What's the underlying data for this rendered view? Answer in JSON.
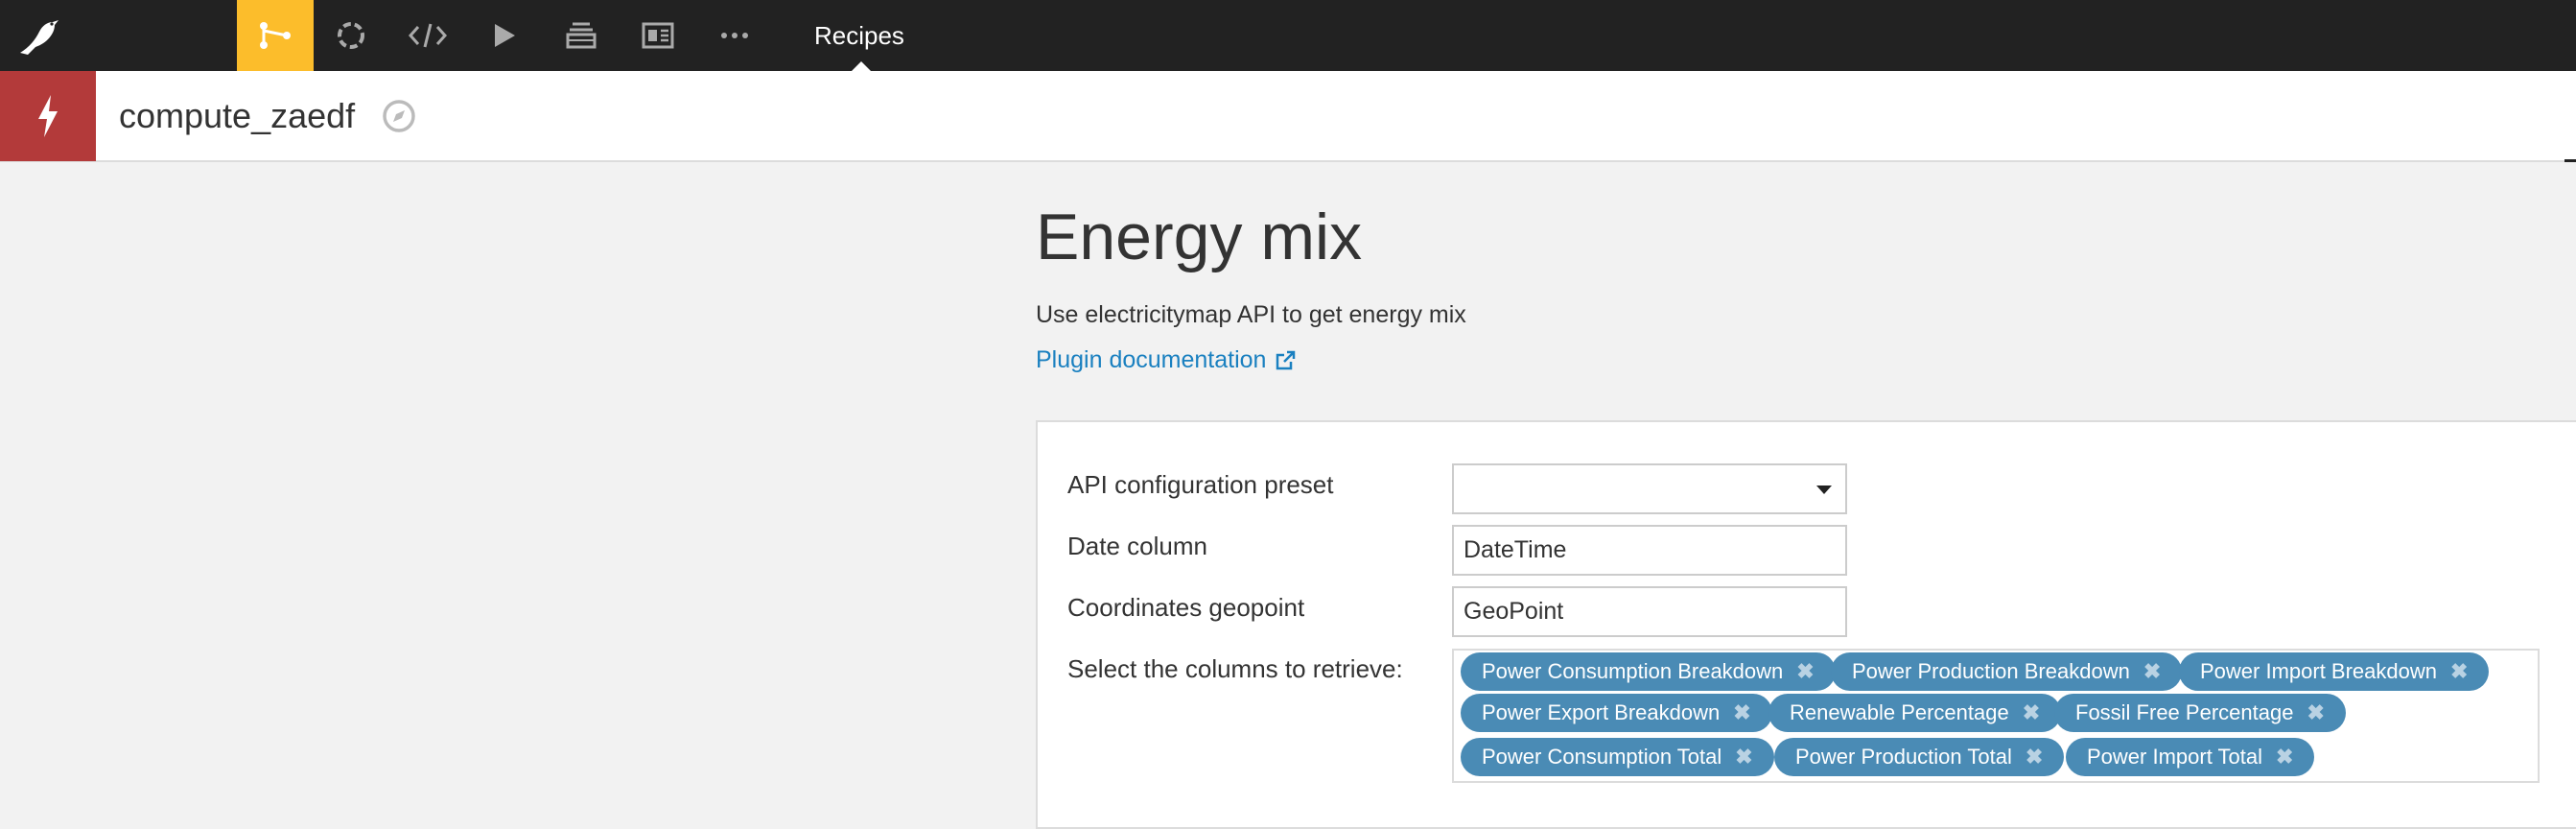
{
  "nav": {
    "active_section": "Recipes",
    "icons": [
      "bird-logo-icon",
      "flow-icon",
      "lab-icon",
      "code-icon",
      "run-icon",
      "stack-icon",
      "dashboard-icon",
      "more-icon"
    ]
  },
  "recipe": {
    "name": "compute_zaedf"
  },
  "plugin": {
    "title": "Energy mix",
    "description": "Use electricitymap API to get energy mix",
    "doc_link": "Plugin documentation"
  },
  "form": {
    "api_preset_label": "API configuration preset",
    "api_preset_value": "",
    "date_column_label": "Date column",
    "date_column_value": "DateTime",
    "geopoint_label": "Coordinates geopoint",
    "geopoint_value": "GeoPoint",
    "columns_label": "Select the columns to retrieve:",
    "columns": [
      "Power Consumption Breakdown",
      "Power Production Breakdown",
      "Power Import Breakdown",
      "Power Export Breakdown",
      "Renewable Percentage",
      "Fossil Free Percentage",
      "Power Consumption Total",
      "Power Production Total",
      "Power Import Total"
    ],
    "remove_glyph": "✖"
  },
  "colors": {
    "nav_bg": "#222222",
    "nav_active": "#fcbd2b",
    "recipe_icon_bg": "#b33a3a",
    "link": "#1a80c0",
    "pill": "#4a8bb5"
  }
}
